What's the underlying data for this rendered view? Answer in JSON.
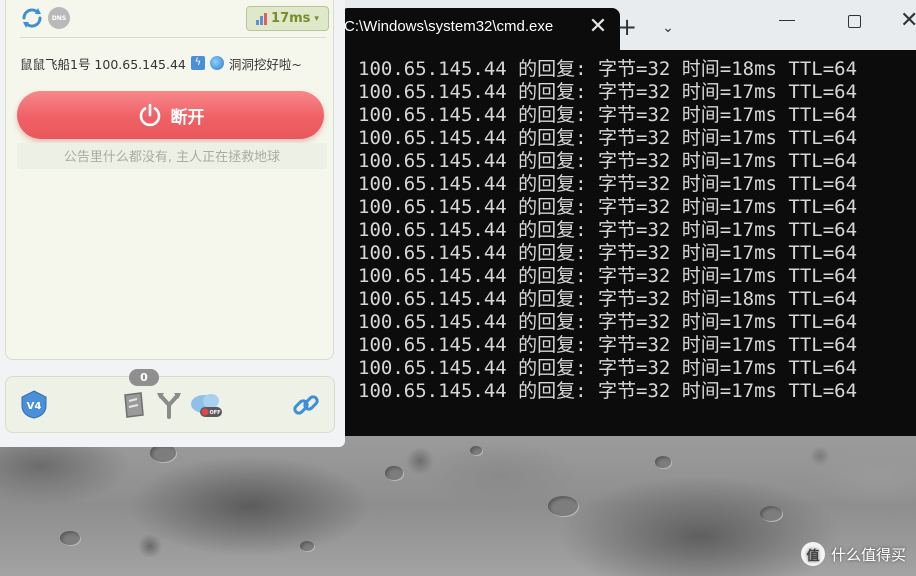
{
  "terminal": {
    "tab_title": "C:\\Windows\\system32\\cmd.exe",
    "close_glyph": "✕",
    "new_tab_glyph": "+",
    "dropdown_glyph": "⌄",
    "window_close_glyph": "✕",
    "lines": [
      "100.65.145.44 的回复: 字节=32 时间=18ms TTL=64",
      "100.65.145.44 的回复: 字节=32 时间=17ms TTL=64",
      "100.65.145.44 的回复: 字节=32 时间=17ms TTL=64",
      "100.65.145.44 的回复: 字节=32 时间=17ms TTL=64",
      "100.65.145.44 的回复: 字节=32 时间=17ms TTL=64",
      "100.65.145.44 的回复: 字节=32 时间=17ms TTL=64",
      "100.65.145.44 的回复: 字节=32 时间=17ms TTL=64",
      "100.65.145.44 的回复: 字节=32 时间=17ms TTL=64",
      "100.65.145.44 的回复: 字节=32 时间=17ms TTL=64",
      "100.65.145.44 的回复: 字节=32 时间=17ms TTL=64",
      "100.65.145.44 的回复: 字节=32 时间=18ms TTL=64",
      "100.65.145.44 的回复: 字节=32 时间=17ms TTL=64",
      "100.65.145.44 的回复: 字节=32 时间=17ms TTL=64",
      "100.65.145.44 的回复: 字节=32 时间=17ms TTL=64",
      "100.65.145.44 的回复: 字节=32 时间=17ms TTL=64"
    ]
  },
  "client": {
    "dns_label": "DNS",
    "ping_label": "17ms",
    "ping_caret": "▾",
    "server_name": "鼠鼠飞船1号 100.65.145.44",
    "flash_glyph": "ϟ",
    "server_tip": "洞洞挖好啦~",
    "disconnect_label": "断开",
    "notice": "公告里什么都没有, 主人正在拯救地球",
    "badge_count": "0",
    "v4_label": "V4",
    "off_label": "OFF",
    "colors": {
      "button": "#ef6166",
      "ping_text": "#7c8a2e",
      "panel": "#f5f7ec"
    }
  },
  "watermark": {
    "logo": "值",
    "text": "什么值得买"
  },
  "icons": [
    "refresh-icon",
    "dns-icon",
    "bar-chart-icon",
    "flash-icon",
    "globe-icon",
    "power-icon",
    "v4-icon",
    "shield-icon",
    "fork-icon",
    "cloud-toggle-icon",
    "link-icon"
  ]
}
